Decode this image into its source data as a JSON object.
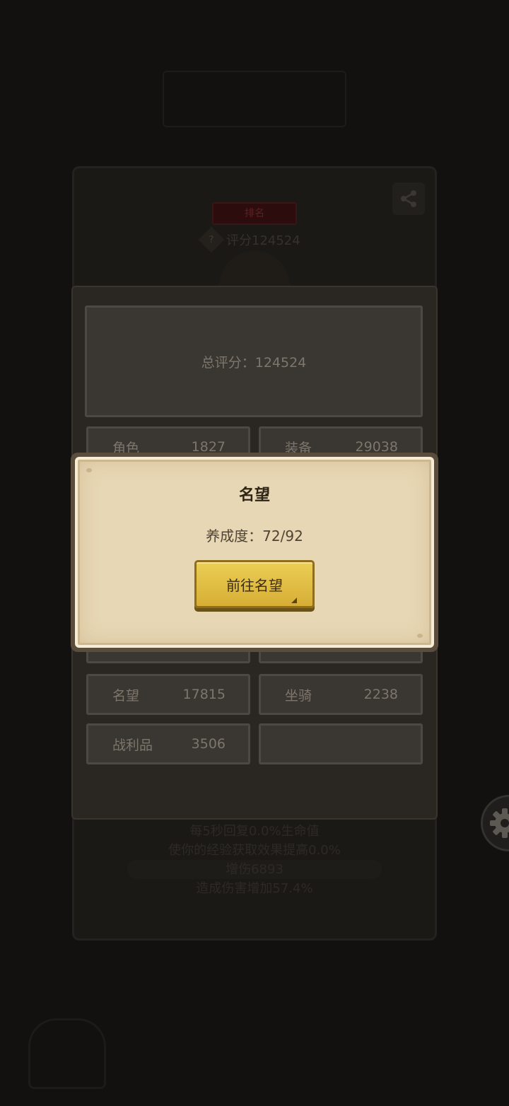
{
  "background": {
    "rank_badge": "排名",
    "score_label": "评分124524",
    "help_glyph": "?",
    "bottom_lines": [
      "每5秒回复0.0%生命值",
      "使你的经验获取效果提高0.0%",
      "增伤6893",
      "造成伤害增加57.4%"
    ]
  },
  "score_panel": {
    "total_label": "总评分：124524",
    "stats": [
      {
        "name": "角色",
        "value": "1827"
      },
      {
        "name": "装备",
        "value": "29038"
      },
      {
        "name": "名望",
        "value": "17815"
      },
      {
        "name": "坐骑",
        "value": "2238"
      },
      {
        "name": "战利品",
        "value": "3506"
      },
      {
        "name": "",
        "value": ""
      }
    ]
  },
  "popup": {
    "title": "名望",
    "progress_text": "养成度：72/92",
    "goto_button_label": "前往名望"
  },
  "colors": {
    "popup_bg": "#e8d7b4",
    "button_gold": "#e3c04a",
    "panel_bg": "#2a2723"
  },
  "icons": [
    "help-icon",
    "share-icon",
    "gear-icon"
  ]
}
